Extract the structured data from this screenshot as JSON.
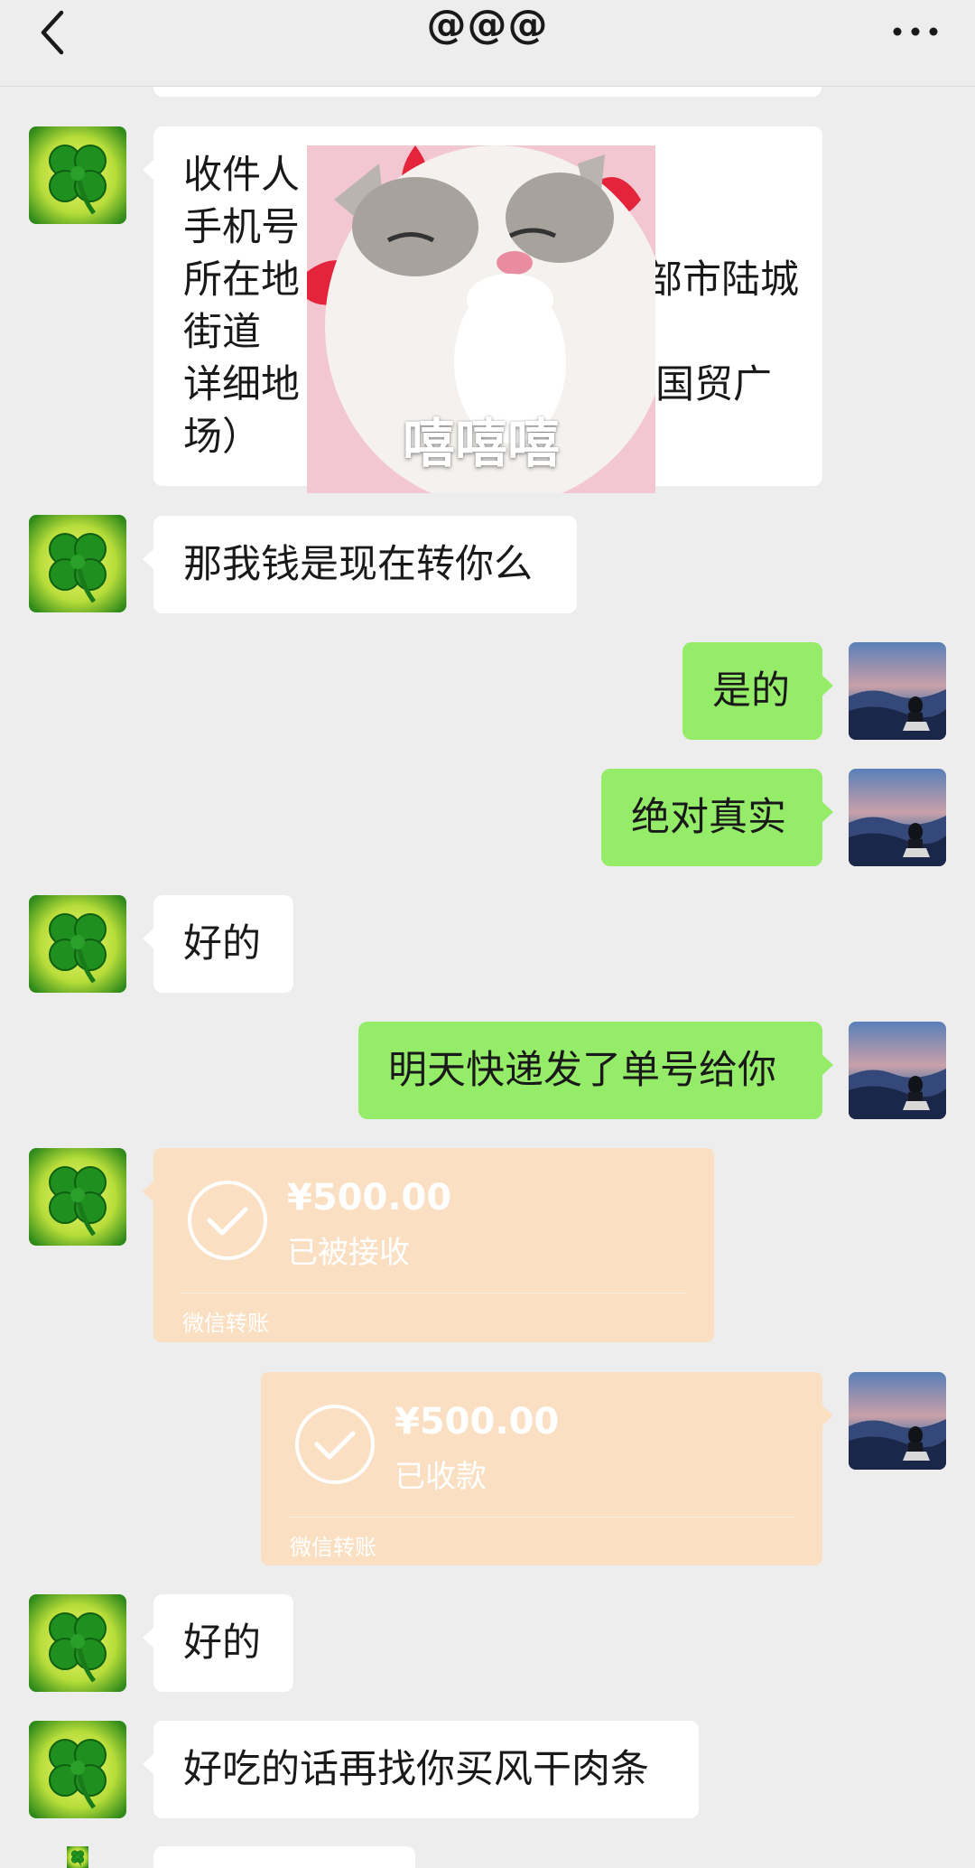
{
  "header": {
    "title": "@@@"
  },
  "address_message": {
    "lines": [
      "收件人",
      "手机号",
      "所在地",
      "部市陆城",
      "街道",
      "详细地",
      "国贸广",
      "场）"
    ]
  },
  "sticker": {
    "caption": "嘻嘻嘻"
  },
  "messages": {
    "m1": "那我钱是现在转你么",
    "m2": "是的",
    "m3": "绝对真实",
    "m4": "好的",
    "m5": "明天快递发了单号给你",
    "m8": "好的",
    "m9": "好吃的话再找你买风干肉条"
  },
  "transfers": {
    "received": {
      "amount": "¥500.00",
      "status": "已被接收",
      "footer": "微信转账"
    },
    "collected": {
      "amount": "¥500.00",
      "status": "已收款",
      "footer": "微信转账"
    }
  },
  "colors": {
    "background": "#ededed",
    "outgoing_bubble": "#95ec69",
    "incoming_bubble": "#ffffff",
    "transfer_card": "#fbdfc2"
  },
  "icons": {
    "back": "chevron-left-icon",
    "more": "more-dots-icon",
    "transfer": "check-circle-icon"
  }
}
